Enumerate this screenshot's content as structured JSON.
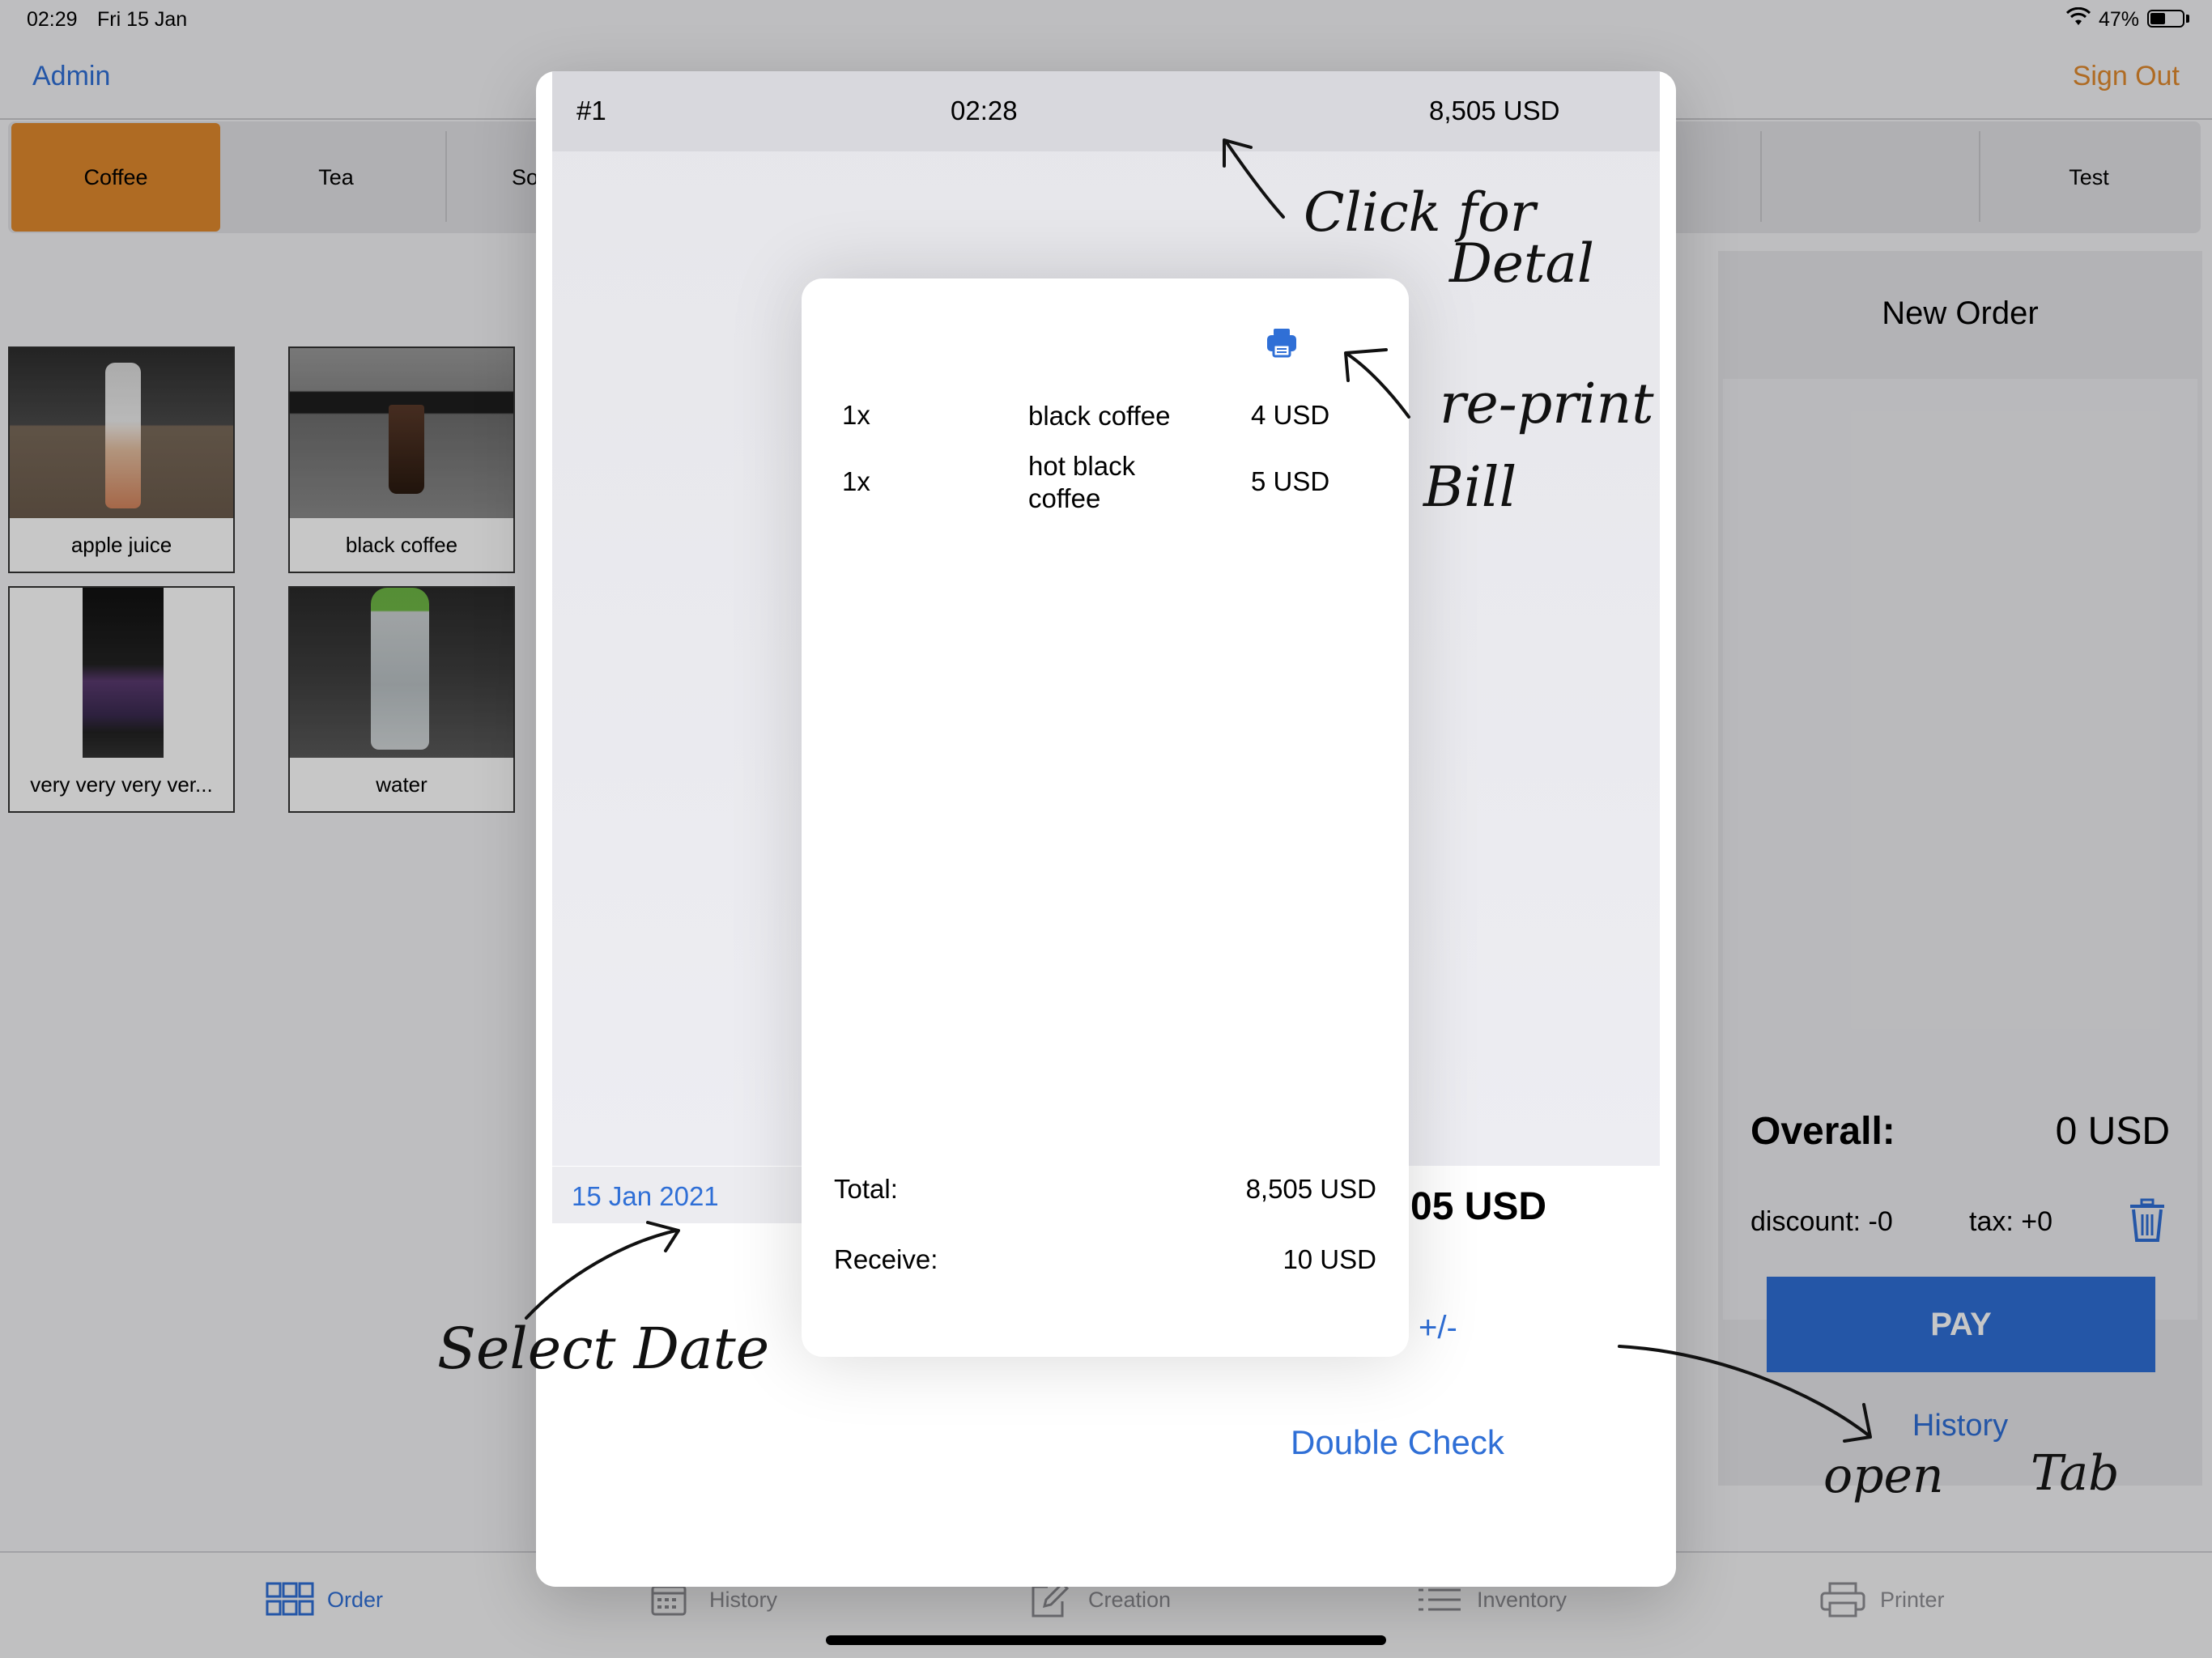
{
  "status_bar": {
    "time": "02:29",
    "date": "Fri 15 Jan",
    "battery": "47%"
  },
  "nav": {
    "left": "Admin",
    "right": "Sign Out"
  },
  "categories": [
    {
      "label": "Coffee"
    },
    {
      "label": "Tea"
    },
    {
      "label": "Sof"
    },
    {
      "label": "Test"
    }
  ],
  "products": [
    {
      "label": "apple juice"
    },
    {
      "label": "black coffee"
    },
    {
      "label": "very very very ver..."
    },
    {
      "label": "water"
    }
  ],
  "order_panel": {
    "title": "New Order",
    "overall_label": "Overall:",
    "overall_value": "0 USD",
    "discount": "discount: -0",
    "tax": "tax: +0",
    "pay": "PAY",
    "history": "History"
  },
  "tabs": [
    {
      "label": "Order",
      "icon": "grid-icon"
    },
    {
      "label": "History",
      "icon": "calendar-icon"
    },
    {
      "label": "Creation",
      "icon": "compose-icon"
    },
    {
      "label": "Inventory",
      "icon": "list-icon"
    },
    {
      "label": "Printer",
      "icon": "printer-icon"
    }
  ],
  "history_sheet": {
    "order": {
      "number": "#1",
      "time": "02:28",
      "amount": "8,505 USD"
    },
    "date": "15 Jan 2021",
    "total_partial": "05 USD",
    "adjust": "+/-",
    "double_check": "Double Check"
  },
  "order_detail": {
    "items": [
      {
        "qty": "1x",
        "name": "black coffee",
        "price": "4 USD"
      },
      {
        "qty": "1x",
        "name": "hot black coffee",
        "price": "5 USD"
      }
    ],
    "total_label": "Total:",
    "total_value": "8,505 USD",
    "receive_label": "Receive:",
    "receive_value": "10 USD"
  },
  "annotations": {
    "click_for": "Click for",
    "detail": "Detal",
    "reprint": "re-print",
    "bill": "Bill",
    "select_date": "Select Date",
    "open": "open",
    "tab": "Tab"
  },
  "colors": {
    "accent": "#2f6fd6",
    "active_category": "#e08a2e",
    "sign_out": "#e08a2e"
  }
}
